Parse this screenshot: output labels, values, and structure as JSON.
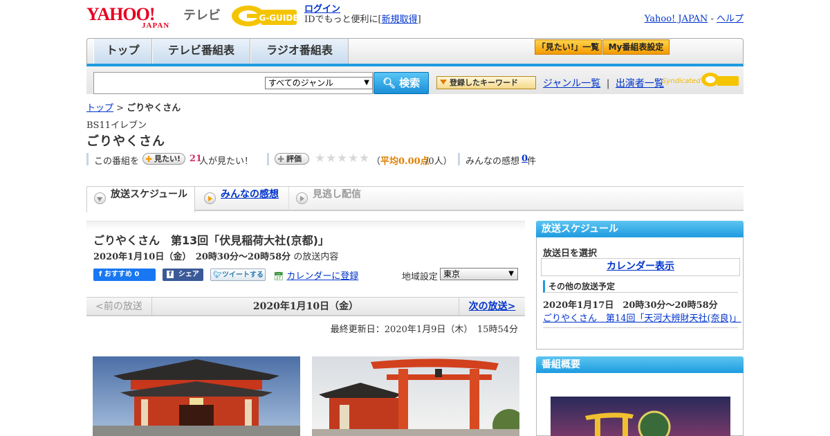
{
  "header": {
    "yahoo_logo_top": "YAHOO!",
    "yahoo_logo_bottom": "JAPAN",
    "tv_label": "テレビ",
    "gguide_logo": "G-GUIDE",
    "login_link": "ログイン",
    "login_prefix": "IDでもっと便利に[",
    "register_link": "新規取得",
    "login_suffix": "]",
    "yahoo_japan_link": "Yahoo! JAPAN",
    "separator": " - ",
    "help_link": "ヘルプ"
  },
  "nav": {
    "tabs": [
      {
        "label": "トップ"
      },
      {
        "label": "テレビ番組表"
      },
      {
        "label": "ラジオ番組表"
      }
    ],
    "want_list_button": "「見たい!」一覧",
    "my_schedule_button": "My番組表設定"
  },
  "search": {
    "placeholder": "",
    "genre_selected": "すべてのジャンル",
    "search_button": "検索",
    "keyword_button": "登録したキーワード",
    "genre_list_link": "ジャンル一覧",
    "divider": "|",
    "performer_list_link": "出演者一覧",
    "syndicated": "Syndicated"
  },
  "breadcrumb": {
    "top_link": "トップ",
    "separator": " > ",
    "current": "ごりやくさん"
  },
  "program": {
    "channel": "BS11イレブン",
    "title": "ごりやくさん",
    "stats": {
      "want_prefix": "この番組を",
      "want_button": "見たい!",
      "want_count": "21",
      "want_suffix": "人が見たい！",
      "rate_button": "評価",
      "rating_text_open": "（",
      "rating_label": "平均0.00点",
      "rating_text_close": "/0人）",
      "impressions_label": "みんなの感想",
      "impressions_count": "0",
      "impressions_unit": "件",
      "stars_filled": 0,
      "stars_total": 5
    }
  },
  "tabs": [
    {
      "label": "放送スケジュール",
      "state": "active"
    },
    {
      "label": "みんなの感想",
      "state": "link"
    },
    {
      "label": "見逃し配信",
      "state": "disabled"
    }
  ],
  "episode": {
    "title": "ごりやくさん　第13回「伏見稲荷大社(京都)」",
    "date_time": "2020年1月10日（金）　20時30分～20時58分",
    "date_suffix": "の放送内容",
    "fb_like": "おすすめ 0",
    "fb_share": "シェア",
    "tweet": "ツイートする",
    "calendar_register": "カレンダーに登録",
    "region_label": "地域設定",
    "region_selected": "東京"
  },
  "pager": {
    "prev": "<前の放送",
    "current": "2020年1月10日（金）",
    "next": "次の放送>"
  },
  "updated": "最終更新日：2020年1月9日（木）　15時54分",
  "sidebar": {
    "schedule_head": "放送スケジュール",
    "select_date": "放送日を選択",
    "calendar_button": "カレンダー表示",
    "other_head": "その他の放送予定",
    "other_date": "2020年1月17日　20時30分～20時58分",
    "other_link": "ごりやくさん　第14回「天河大辨財天社(奈良)」",
    "overview_head": "番組概要"
  },
  "colors": {
    "accent_blue": "#1e9be0",
    "link_blue": "#0033cc",
    "yahoo_red": "#e60020",
    "want_pink": "#d0306a",
    "rating_orange": "#e08000"
  }
}
